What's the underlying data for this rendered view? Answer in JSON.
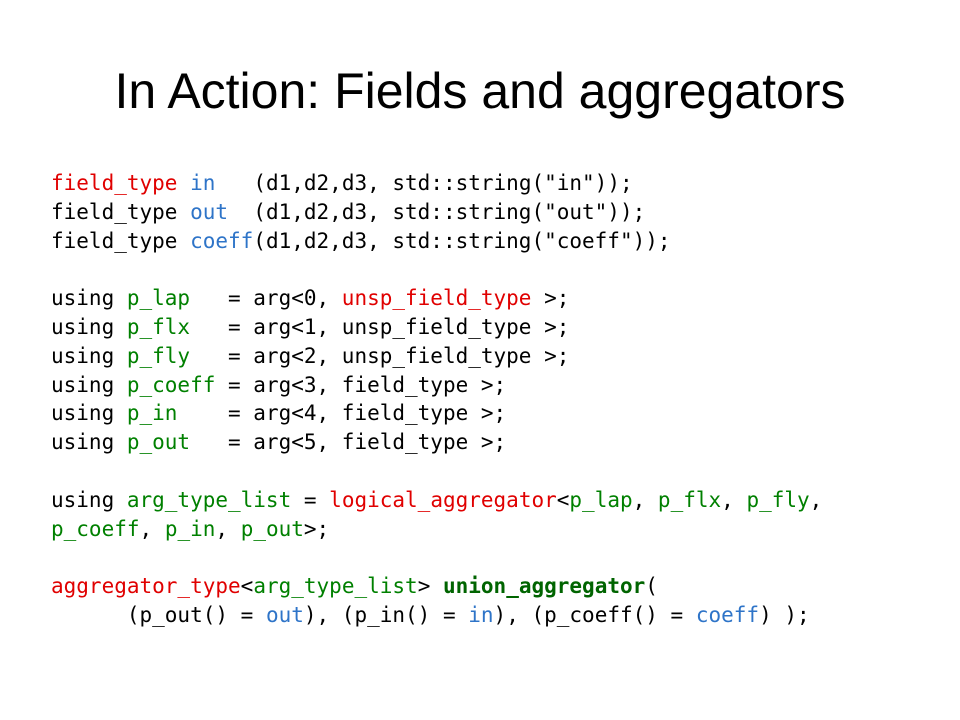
{
  "title": "In Action: Fields and aggregators",
  "colors": {
    "red": "#e00000",
    "blue": "#2e74c8",
    "green": "#008000",
    "bold_green": "#006400",
    "plain": "#000000"
  },
  "code_lines": [
    [
      {
        "text": "field_type",
        "style": "red"
      },
      {
        "text": " ",
        "style": "plain"
      },
      {
        "text": "in",
        "style": "blue"
      },
      {
        "text": "   (d1,d2,d3, std::string(\"in\"));",
        "style": "plain"
      }
    ],
    [
      {
        "text": "field_type ",
        "style": "plain"
      },
      {
        "text": "out",
        "style": "blue"
      },
      {
        "text": "  (d1,d2,d3, std::string(\"out\"));",
        "style": "plain"
      }
    ],
    [
      {
        "text": "field_type ",
        "style": "plain"
      },
      {
        "text": "coeff",
        "style": "blue"
      },
      {
        "text": "(d1,d2,d3, std::string(\"coeff\"));",
        "style": "plain"
      }
    ],
    [],
    [
      {
        "text": "using ",
        "style": "plain"
      },
      {
        "text": "p_lap",
        "style": "green"
      },
      {
        "text": "   = arg<0, ",
        "style": "plain"
      },
      {
        "text": "unsp_field_type",
        "style": "red"
      },
      {
        "text": " >;",
        "style": "plain"
      }
    ],
    [
      {
        "text": "using ",
        "style": "plain"
      },
      {
        "text": "p_flx",
        "style": "green"
      },
      {
        "text": "   = arg<1, unsp_field_type >;",
        "style": "plain"
      }
    ],
    [
      {
        "text": "using ",
        "style": "plain"
      },
      {
        "text": "p_fly",
        "style": "green"
      },
      {
        "text": "   = arg<2, unsp_field_type >;",
        "style": "plain"
      }
    ],
    [
      {
        "text": "using ",
        "style": "plain"
      },
      {
        "text": "p_coeff",
        "style": "green"
      },
      {
        "text": " = arg<3, field_type >;",
        "style": "plain"
      }
    ],
    [
      {
        "text": "using ",
        "style": "plain"
      },
      {
        "text": "p_in",
        "style": "green"
      },
      {
        "text": "    = arg<4, field_type >;",
        "style": "plain"
      }
    ],
    [
      {
        "text": "using ",
        "style": "plain"
      },
      {
        "text": "p_out",
        "style": "green"
      },
      {
        "text": "   = arg<5, field_type >;",
        "style": "plain"
      }
    ],
    [],
    [
      {
        "text": "using ",
        "style": "plain"
      },
      {
        "text": "arg_type_list",
        "style": "green"
      },
      {
        "text": " = ",
        "style": "plain"
      },
      {
        "text": "logical_aggregator",
        "style": "red"
      },
      {
        "text": "<",
        "style": "plain"
      },
      {
        "text": "p_lap",
        "style": "green"
      },
      {
        "text": ", ",
        "style": "plain"
      },
      {
        "text": "p_flx",
        "style": "green"
      },
      {
        "text": ", ",
        "style": "plain"
      },
      {
        "text": "p_fly",
        "style": "green"
      },
      {
        "text": ",",
        "style": "plain"
      }
    ],
    [
      {
        "text": "p_coeff",
        "style": "green"
      },
      {
        "text": ", ",
        "style": "plain"
      },
      {
        "text": "p_in",
        "style": "green"
      },
      {
        "text": ", ",
        "style": "plain"
      },
      {
        "text": "p_out",
        "style": "green"
      },
      {
        "text": ">;",
        "style": "plain"
      }
    ],
    [],
    [
      {
        "text": "aggregator_type",
        "style": "red"
      },
      {
        "text": "<",
        "style": "plain"
      },
      {
        "text": "arg_type_list",
        "style": "green"
      },
      {
        "text": "> ",
        "style": "plain"
      },
      {
        "text": "union_aggregator",
        "style": "bold-green"
      },
      {
        "text": "(",
        "style": "plain"
      }
    ],
    [
      {
        "text": "      (p_out() = ",
        "style": "plain"
      },
      {
        "text": "out",
        "style": "blue"
      },
      {
        "text": "), (p_in() = ",
        "style": "plain"
      },
      {
        "text": "in",
        "style": "blue"
      },
      {
        "text": "), (p_coeff() = ",
        "style": "plain"
      },
      {
        "text": "coeff",
        "style": "blue"
      },
      {
        "text": ") );",
        "style": "plain"
      }
    ]
  ]
}
